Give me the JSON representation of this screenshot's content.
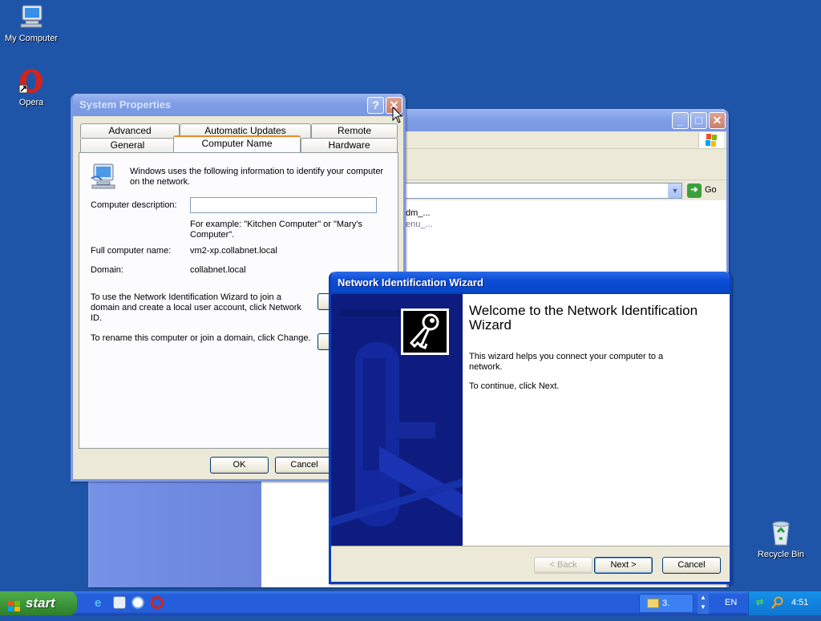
{
  "desktop": {
    "icons": [
      {
        "label": "My Computer"
      },
      {
        "label": "Opera"
      },
      {
        "label": "Recycle Bin"
      }
    ]
  },
  "explorer": {
    "go_label": "Go",
    "items": [
      "dm_...",
      "enu_..."
    ]
  },
  "system_properties": {
    "title": "System Properties",
    "help_glyph": "?",
    "close_glyph": "✕",
    "tabs_row1": [
      "Advanced",
      "Automatic Updates",
      "Remote"
    ],
    "tabs_row2": [
      "General",
      "Computer Name",
      "Hardware"
    ],
    "active_tab": "Computer Name",
    "intro": "Windows uses the following information to identify your computer on the network.",
    "description_label": "Computer description:",
    "description_value": "",
    "example": "For example: \"Kitchen Computer\" or \"Mary's Computer\".",
    "full_name_label": "Full computer name:",
    "full_name_value": "vm2-xp.collabnet.local",
    "domain_label": "Domain:",
    "domain_value": "collabnet.local",
    "network_id_text": "To use the Network Identification Wizard to join a domain and create a local user account, click Network ID.",
    "network_id_btn": "N",
    "rename_text": "To rename this computer or join a domain, click Change.",
    "ok_label": "OK",
    "cancel_label": "Cancel"
  },
  "wizard": {
    "title": "Network Identification Wizard",
    "heading": "Welcome to the Network Identification Wizard",
    "body1": "This wizard helps you connect your computer to a network.",
    "body2": "To continue, click Next.",
    "back_label": "< Back",
    "next_label": "Next >",
    "cancel_label": "Cancel"
  },
  "taskbar": {
    "start_label": "start",
    "task_label": "3.",
    "language": "EN",
    "clock": "4:51"
  },
  "colors": {
    "desktop": "#1f55a8",
    "titlebar_active": "#0a4cd6",
    "wizard_banner": "#0d1c7e",
    "start_green": "#3c973a"
  }
}
